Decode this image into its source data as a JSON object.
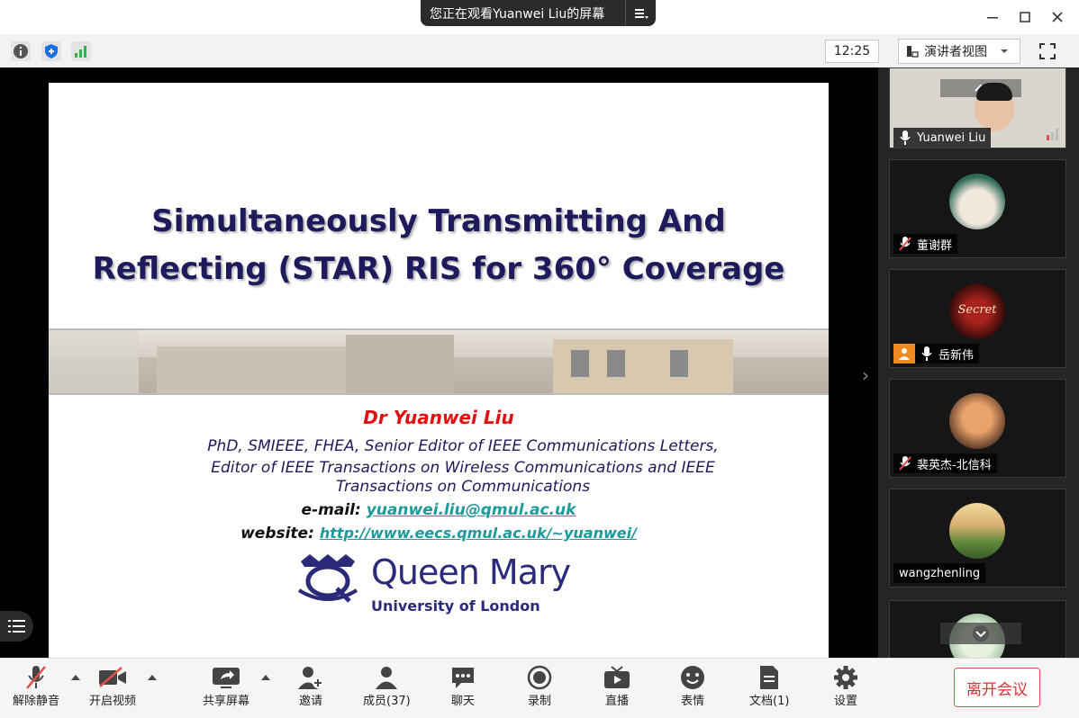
{
  "share_banner": {
    "text": "您正在观看Yuanwei Liu的屏幕"
  },
  "toolbar": {
    "time": "12:25",
    "view_label": "演讲者视图"
  },
  "slide": {
    "title_line1": "Simultaneously Transmitting And",
    "title_line2": "Reflecting (STAR) RIS for 360° Coverage",
    "author": "Dr Yuanwei Liu",
    "cred1": "PhD, SMIEEE, FHEA, Senior Editor of IEEE Communications Letters,",
    "cred2": "Editor of IEEE Transactions on Wireless Communications and IEEE",
    "cred3": "Transactions on Communications",
    "email_label": "e-mail:",
    "email": "yuanwei.liu@qmul.ac.uk",
    "website_label": "website:",
    "website": "http://www.eecs.qmul.ac.uk/~yuanwei/",
    "logo_name": "Queen Mary",
    "logo_sub": "University of London"
  },
  "participants": [
    {
      "name": "Yuanwei Liu",
      "muted": false
    },
    {
      "name": "董谢群",
      "muted": true
    },
    {
      "name": "岳新伟",
      "muted": false
    },
    {
      "name": "裴英杰-北信科",
      "muted": true
    },
    {
      "name": "wangzhenling",
      "muted": false
    },
    {
      "name": "",
      "muted": false
    }
  ],
  "bottombar": {
    "unmute": "解除静音",
    "start_video": "开启视频",
    "share_screen": "共享屏幕",
    "invite": "邀请",
    "members": "成员(37)",
    "chat": "聊天",
    "record": "录制",
    "live": "直播",
    "emoji": "表情",
    "docs": "文档(1)",
    "settings": "设置",
    "leave": "离开会议"
  }
}
